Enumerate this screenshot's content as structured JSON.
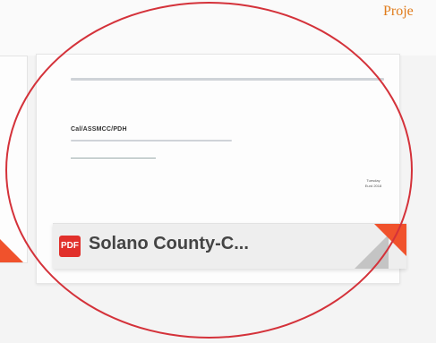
{
  "header": {
    "partial_title": "Proje"
  },
  "file_card": {
    "badge_label": "PDF",
    "file_name": "Solano County-C...",
    "preview": {
      "doc_heading": "Cal/ASSMCC/PDH",
      "side_text": "Tuesday Eurd 2018"
    }
  },
  "colors": {
    "accent_orange": "#e07b1a",
    "fold_red": "#f0522c",
    "annotation_red": "#d4323a",
    "pdf_red": "#e1302b"
  }
}
